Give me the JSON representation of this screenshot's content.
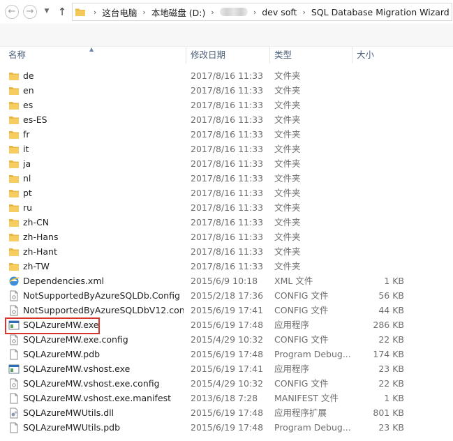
{
  "address_bar": {
    "crumbs": [
      "这台电脑",
      "本地磁盘 (D:)",
      "",
      "dev soft",
      "SQL Database Migration Wizard"
    ]
  },
  "columns": {
    "name": "名称",
    "date": "修改日期",
    "type": "类型",
    "size": "大小"
  },
  "files": [
    {
      "name": "de",
      "date": "2017/8/16 11:33",
      "type": "文件夹",
      "size": "",
      "icon": "folder-icon"
    },
    {
      "name": "en",
      "date": "2017/8/16 11:33",
      "type": "文件夹",
      "size": "",
      "icon": "folder-icon"
    },
    {
      "name": "es",
      "date": "2017/8/16 11:33",
      "type": "文件夹",
      "size": "",
      "icon": "folder-icon"
    },
    {
      "name": "es-ES",
      "date": "2017/8/16 11:33",
      "type": "文件夹",
      "size": "",
      "icon": "folder-icon"
    },
    {
      "name": "fr",
      "date": "2017/8/16 11:33",
      "type": "文件夹",
      "size": "",
      "icon": "folder-icon"
    },
    {
      "name": "it",
      "date": "2017/8/16 11:33",
      "type": "文件夹",
      "size": "",
      "icon": "folder-icon"
    },
    {
      "name": "ja",
      "date": "2017/8/16 11:33",
      "type": "文件夹",
      "size": "",
      "icon": "folder-icon"
    },
    {
      "name": "nl",
      "date": "2017/8/16 11:33",
      "type": "文件夹",
      "size": "",
      "icon": "folder-icon"
    },
    {
      "name": "pt",
      "date": "2017/8/16 11:33",
      "type": "文件夹",
      "size": "",
      "icon": "folder-icon"
    },
    {
      "name": "ru",
      "date": "2017/8/16 11:33",
      "type": "文件夹",
      "size": "",
      "icon": "folder-icon"
    },
    {
      "name": "zh-CN",
      "date": "2017/8/16 11:33",
      "type": "文件夹",
      "size": "",
      "icon": "folder-icon"
    },
    {
      "name": "zh-Hans",
      "date": "2017/8/16 11:33",
      "type": "文件夹",
      "size": "",
      "icon": "folder-icon"
    },
    {
      "name": "zh-Hant",
      "date": "2017/8/16 11:33",
      "type": "文件夹",
      "size": "",
      "icon": "folder-icon"
    },
    {
      "name": "zh-TW",
      "date": "2017/8/16 11:33",
      "type": "文件夹",
      "size": "",
      "icon": "folder-icon"
    },
    {
      "name": "Dependencies.xml",
      "date": "2015/6/9 10:18",
      "type": "XML 文件",
      "size": "1 KB",
      "icon": "xml-file-icon"
    },
    {
      "name": "NotSupportedByAzureSQLDb.Config",
      "date": "2015/2/18 17:36",
      "type": "CONFIG 文件",
      "size": "56 KB",
      "icon": "config-file-icon"
    },
    {
      "name": "NotSupportedByAzureSQLDbV12.con...",
      "date": "2015/6/19 17:41",
      "type": "CONFIG 文件",
      "size": "44 KB",
      "icon": "config-file-icon"
    },
    {
      "name": "SQLAzureMW.exe",
      "date": "2015/6/19 17:48",
      "type": "应用程序",
      "size": "286 KB",
      "icon": "exe-file-icon"
    },
    {
      "name": "SQLAzureMW.exe.config",
      "date": "2015/4/29 10:32",
      "type": "CONFIG 文件",
      "size": "22 KB",
      "icon": "config-file-icon"
    },
    {
      "name": "SQLAzureMW.pdb",
      "date": "2015/6/19 17:48",
      "type": "Program Debug...",
      "size": "174 KB",
      "icon": "pdb-file-icon"
    },
    {
      "name": "SQLAzureMW.vshost.exe",
      "date": "2015/6/19 17:41",
      "type": "应用程序",
      "size": "23 KB",
      "icon": "exe-file-icon"
    },
    {
      "name": "SQLAzureMW.vshost.exe.config",
      "date": "2015/4/29 10:32",
      "type": "CONFIG 文件",
      "size": "22 KB",
      "icon": "config-file-icon"
    },
    {
      "name": "SQLAzureMW.vshost.exe.manifest",
      "date": "2013/6/18 7:28",
      "type": "MANIFEST 文件",
      "size": "1 KB",
      "icon": "manifest-file-icon"
    },
    {
      "name": "SQLAzureMWUtils.dll",
      "date": "2015/6/19 17:48",
      "type": "应用程序扩展",
      "size": "801 KB",
      "icon": "dll-file-icon"
    },
    {
      "name": "SQLAzureMWUtils.pdb",
      "date": "2015/6/19 17:48",
      "type": "Program Debug...",
      "size": "23 KB",
      "icon": "pdb-file-icon"
    }
  ],
  "highlighted_file": "SQLAzureMW.exe",
  "colors": {
    "folder": "#e8b740",
    "highlight_border": "#d9342b",
    "header_text": "#4c607a"
  }
}
